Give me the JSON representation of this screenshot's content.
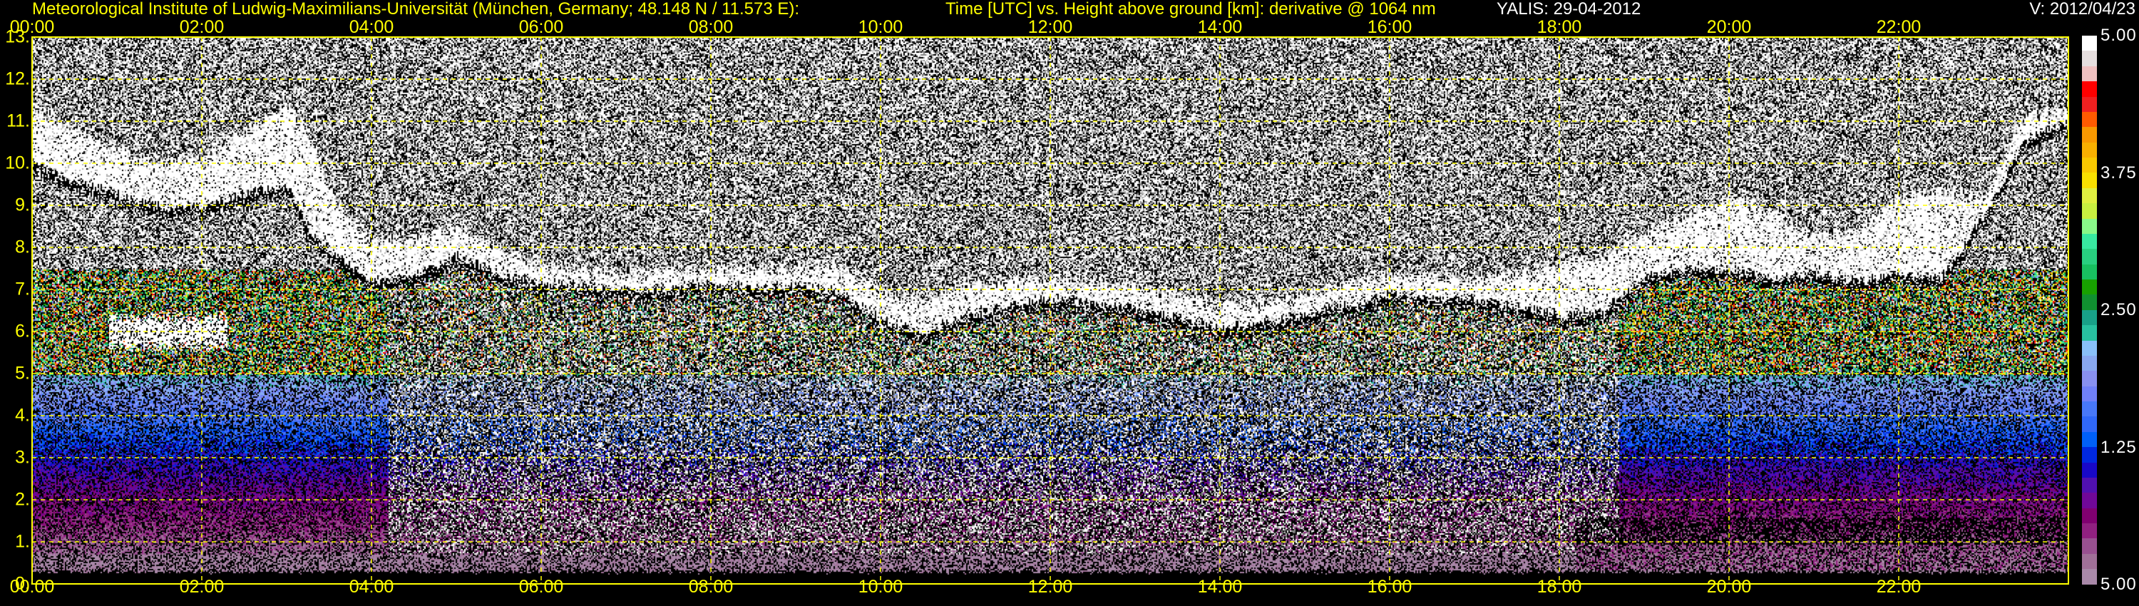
{
  "header": {
    "institute": "Meteorological Institute of Ludwig-Maximilians-Universität (München, Germany; 48.148 N / 11.573 E):",
    "plot_description": "Time [UTC] vs. Height above ground [km]: derivative @ 1064 nm",
    "instrument_date": "YALIS: 29-04-2012",
    "version": "V: 2012/04/23"
  },
  "colors": {
    "text": "#ffff00",
    "grid": "#ffff00",
    "background": "#000000"
  },
  "chart_data": {
    "type": "heatmap",
    "title": "Time [UTC] vs. Height above ground [km]: derivative @ 1064 nm",
    "xlabel": "Time [UTC]",
    "ylabel": "Height above ground [km]",
    "xlim": [
      0,
      24
    ],
    "ylim": [
      0,
      13
    ],
    "grid": true,
    "x_ticks": [
      0,
      2,
      4,
      6,
      8,
      10,
      12,
      14,
      16,
      18,
      20,
      22
    ],
    "x_tick_labels": [
      "00:00",
      "02:00",
      "04:00",
      "06:00",
      "08:00",
      "10:00",
      "12:00",
      "14:00",
      "16:00",
      "18:00",
      "20:00",
      "22:00"
    ],
    "y_ticks": [
      0,
      1,
      2,
      3,
      4,
      5,
      6,
      7,
      8,
      9,
      10,
      11,
      12,
      13
    ],
    "y_tick_labels": [
      "0.",
      "1.",
      "2.",
      "3.",
      "4.",
      "5.",
      "6.",
      "7.",
      "8.",
      "9.",
      "10.",
      "11.",
      "12.",
      "13."
    ],
    "colorbar": {
      "position": "right",
      "tick_labels_top_to_bottom": [
        "5.00",
        "3.75",
        "2.50",
        "1.25",
        "5.00"
      ],
      "colors_top_to_bottom": [
        "#ffffff",
        "#e6dede",
        "#f0c0c0",
        "#ff0000",
        "#f02020",
        "#ff5a00",
        "#f89800",
        "#f8b000",
        "#f8c800",
        "#f8e000",
        "#e0f040",
        "#c8f040",
        "#88f888",
        "#38e8a0",
        "#28d080",
        "#18c060",
        "#18a000",
        "#109030",
        "#18a088",
        "#28c0a0",
        "#88c0f8",
        "#88a8f0",
        "#8890f0",
        "#7080f8",
        "#4878f8",
        "#3068f8",
        "#0060f8",
        "#0028e0",
        "#1808c8",
        "#5010b0",
        "#700898",
        "#800070",
        "#902080",
        "#985090",
        "#a07098",
        "#a888a8"
      ]
    },
    "cloud_layer_estimate": {
      "time_h": [
        0,
        0.5,
        1,
        1.5,
        2,
        2.5,
        3,
        3.3,
        3.6,
        4,
        4.5,
        5,
        5.5,
        6,
        7,
        8,
        9,
        9.5,
        10,
        10.5,
        11,
        12,
        13,
        14,
        15,
        16,
        17,
        17.5,
        18,
        18.5,
        19,
        19.5,
        20,
        20.5,
        21,
        21.5,
        22,
        22.5,
        23,
        23.5,
        24
      ],
      "base_km": [
        10.0,
        9.6,
        9.3,
        9.0,
        9.0,
        9.3,
        9.5,
        8.3,
        7.8,
        7.2,
        7.4,
        7.8,
        7.4,
        7.2,
        7.0,
        7.1,
        7.1,
        7.0,
        6.3,
        6.0,
        6.4,
        6.8,
        6.6,
        6.1,
        6.4,
        6.9,
        6.8,
        6.6,
        6.4,
        6.5,
        7.3,
        7.5,
        7.5,
        7.3,
        7.4,
        7.2,
        7.4,
        7.3,
        8.8,
        10.6,
        11.0
      ],
      "top_km": [
        11.3,
        10.8,
        10.3,
        10.0,
        10.2,
        10.8,
        11.4,
        10.5,
        9.0,
        8.2,
        8.2,
        8.5,
        8.0,
        7.6,
        7.4,
        7.5,
        7.5,
        7.6,
        7.0,
        6.7,
        7.1,
        7.3,
        7.1,
        6.6,
        6.9,
        7.4,
        7.2,
        7.4,
        7.6,
        7.8,
        8.3,
        8.8,
        9.2,
        8.8,
        8.3,
        8.4,
        9.2,
        9.4,
        9.2,
        11.2,
        11.3
      ]
    },
    "lower_cloud_estimate": {
      "time_h": [
        0.9,
        2.3
      ],
      "base_km": 5.5,
      "top_km": 6.5
    }
  }
}
